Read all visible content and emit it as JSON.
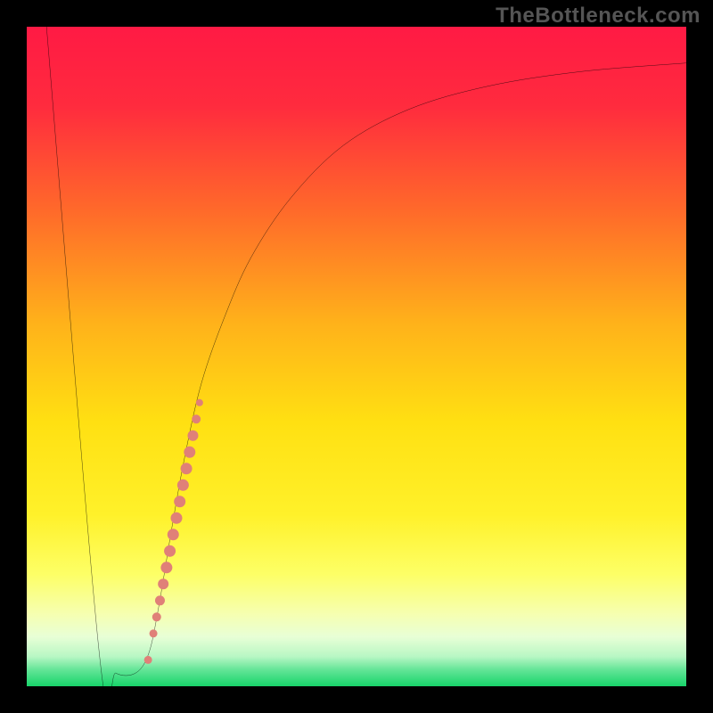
{
  "watermark": "TheBottleneck.com",
  "chart_data": {
    "type": "line",
    "title": "",
    "xlabel": "",
    "ylabel": "",
    "xlim": [
      0,
      100
    ],
    "ylim": [
      0,
      100
    ],
    "background_gradient": {
      "stops": [
        {
          "offset": 0.0,
          "color": "#ff1a44"
        },
        {
          "offset": 0.12,
          "color": "#ff2b3e"
        },
        {
          "offset": 0.28,
          "color": "#ff6a2a"
        },
        {
          "offset": 0.45,
          "color": "#ffb21a"
        },
        {
          "offset": 0.6,
          "color": "#ffe012"
        },
        {
          "offset": 0.74,
          "color": "#fff12a"
        },
        {
          "offset": 0.83,
          "color": "#fdff66"
        },
        {
          "offset": 0.89,
          "color": "#f6ffb0"
        },
        {
          "offset": 0.925,
          "color": "#e8ffd6"
        },
        {
          "offset": 0.955,
          "color": "#b8f7c4"
        },
        {
          "offset": 0.975,
          "color": "#63e597"
        },
        {
          "offset": 1.0,
          "color": "#18d46a"
        }
      ]
    },
    "series": [
      {
        "name": "bottleneck-curve",
        "color": "#000000",
        "width": 2,
        "points": [
          {
            "x": 3.0,
            "y": 100.0
          },
          {
            "x": 11.0,
            "y": 5.0
          },
          {
            "x": 13.5,
            "y": 2.0
          },
          {
            "x": 16.5,
            "y": 2.0
          },
          {
            "x": 18.5,
            "y": 5.0
          },
          {
            "x": 20.0,
            "y": 12.0
          },
          {
            "x": 22.0,
            "y": 24.0
          },
          {
            "x": 24.0,
            "y": 35.0
          },
          {
            "x": 26.5,
            "y": 46.0
          },
          {
            "x": 30.0,
            "y": 56.0
          },
          {
            "x": 34.0,
            "y": 65.0
          },
          {
            "x": 40.0,
            "y": 74.0
          },
          {
            "x": 48.0,
            "y": 82.0
          },
          {
            "x": 58.0,
            "y": 87.5
          },
          {
            "x": 70.0,
            "y": 91.0
          },
          {
            "x": 84.0,
            "y": 93.2
          },
          {
            "x": 100.0,
            "y": 94.5
          }
        ]
      }
    ],
    "scatter": {
      "name": "segment-dots",
      "color": "#e08078",
      "points": [
        {
          "x": 18.4,
          "y": 4.0,
          "r": 4.5
        },
        {
          "x": 19.2,
          "y": 8.0,
          "r": 4.5
        },
        {
          "x": 19.7,
          "y": 10.5,
          "r": 5.0
        },
        {
          "x": 20.2,
          "y": 13.0,
          "r": 5.5
        },
        {
          "x": 20.7,
          "y": 15.5,
          "r": 6.0
        },
        {
          "x": 21.2,
          "y": 18.0,
          "r": 6.5
        },
        {
          "x": 21.7,
          "y": 20.5,
          "r": 6.5
        },
        {
          "x": 22.2,
          "y": 23.0,
          "r": 6.5
        },
        {
          "x": 22.7,
          "y": 25.5,
          "r": 6.5
        },
        {
          "x": 23.2,
          "y": 28.0,
          "r": 6.5
        },
        {
          "x": 23.7,
          "y": 30.5,
          "r": 6.5
        },
        {
          "x": 24.2,
          "y": 33.0,
          "r": 6.5
        },
        {
          "x": 24.7,
          "y": 35.5,
          "r": 6.5
        },
        {
          "x": 25.2,
          "y": 38.0,
          "r": 6.0
        },
        {
          "x": 25.7,
          "y": 40.5,
          "r": 5.0
        },
        {
          "x": 26.2,
          "y": 43.0,
          "r": 4.0
        }
      ]
    }
  }
}
